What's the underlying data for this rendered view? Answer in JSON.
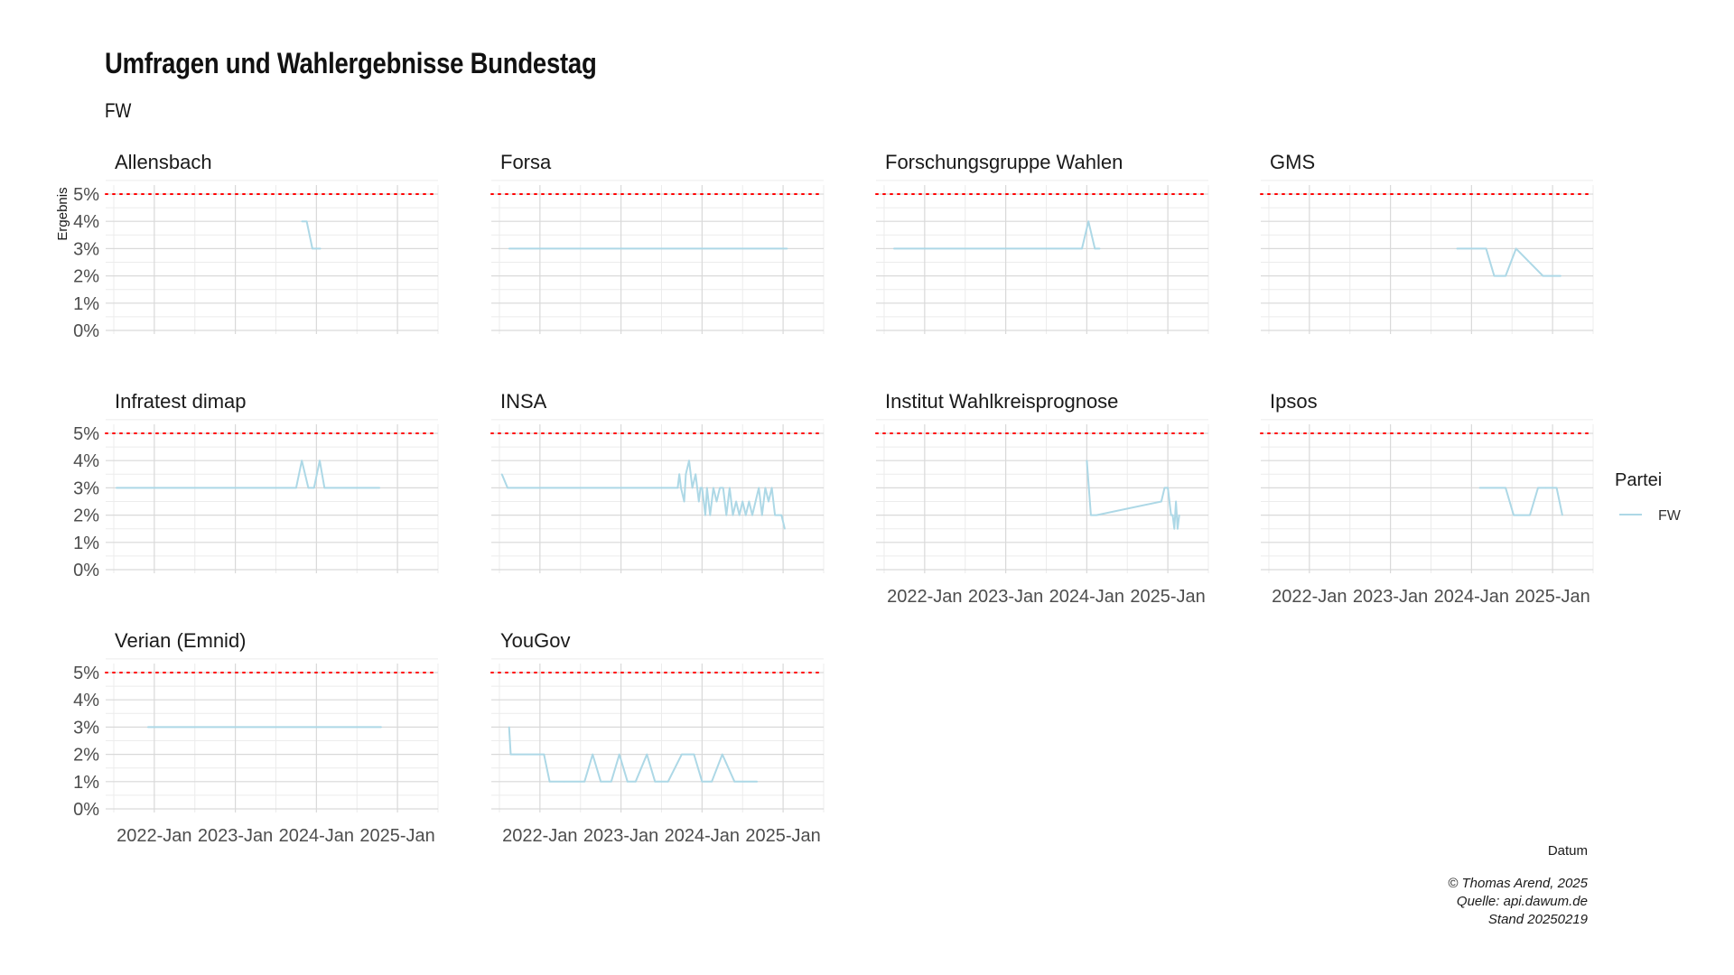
{
  "title": "Umfragen und Wahlergebnisse Bundestag",
  "subtitle": "FW",
  "chart_data": {
    "type": "line",
    "ylabel": "Ergebnis",
    "xlabel": "Datum",
    "ylim": [
      0,
      5
    ],
    "y_ticks": [
      "0%",
      "1%",
      "2%",
      "3%",
      "4%",
      "5%"
    ],
    "x_range": [
      2021.4,
      2025.5
    ],
    "x_ticks": [
      {
        "value": 2022,
        "label": "2022-Jan"
      },
      {
        "value": 2023,
        "label": "2023-Jan"
      },
      {
        "value": 2024,
        "label": "2024-Jan"
      },
      {
        "value": 2025,
        "label": "2025-Jan"
      }
    ],
    "threshold": 5,
    "threshold_color": "#ff0000",
    "line_color": "#add8e6",
    "grid": true,
    "legend_title": "Partei",
    "legend_position": "right",
    "series_name": "FW",
    "panels": [
      {
        "name": "Allensbach",
        "x": [
          2023.82,
          2023.88,
          2023.95,
          2024.05
        ],
        "y": [
          4,
          4,
          3,
          3
        ]
      },
      {
        "name": "Forsa",
        "x": [
          2021.62,
          2025.05
        ],
        "y": [
          3,
          3
        ]
      },
      {
        "name": "Forschungsgruppe Wahlen",
        "x": [
          2021.62,
          2023.94,
          2024.02,
          2024.1,
          2024.16
        ],
        "y": [
          3,
          3,
          4,
          3,
          3
        ]
      },
      {
        "name": "GMS",
        "x": [
          2023.82,
          2024.18,
          2024.28,
          2024.42,
          2024.55,
          2024.88,
          2025.1
        ],
        "y": [
          3,
          3,
          2,
          2,
          3,
          2,
          2
        ]
      },
      {
        "name": "Infratest dimap",
        "x": [
          2021.53,
          2023.75,
          2023.82,
          2023.9,
          2023.97,
          2024.04,
          2024.1,
          2024.5,
          2024.78
        ],
        "y": [
          3,
          3,
          4,
          3,
          3,
          4,
          3,
          3,
          3
        ]
      },
      {
        "name": "INSA",
        "x": [
          2021.53,
          2021.6,
          2023.7,
          2023.72,
          2023.74,
          2023.78,
          2023.8,
          2023.84,
          2023.88,
          2023.92,
          2023.94,
          2023.96,
          2023.98,
          2024.0,
          2024.04,
          2024.06,
          2024.1,
          2024.14,
          2024.18,
          2024.22,
          2024.26,
          2024.3,
          2024.34,
          2024.38,
          2024.42,
          2024.46,
          2024.5,
          2024.54,
          2024.58,
          2024.62,
          2024.66,
          2024.7,
          2024.74,
          2024.78,
          2024.82,
          2024.86,
          2024.9,
          2024.94,
          2024.98,
          2025.02
        ],
        "y": [
          3.5,
          3,
          3,
          3.5,
          3,
          2.5,
          3.5,
          4,
          3,
          3.5,
          3,
          2.5,
          3,
          3,
          2,
          3,
          2,
          3,
          2.5,
          3,
          3,
          2,
          3,
          2,
          2.5,
          2,
          2.5,
          2,
          2.5,
          2,
          2.5,
          3,
          2,
          3,
          2.5,
          3,
          2,
          2,
          2,
          1.5
        ]
      },
      {
        "name": "Institut Wahlkreisprognose",
        "x": [
          2024.0,
          2024.05,
          2024.12,
          2024.92,
          2024.96,
          2025.0,
          2025.04,
          2025.06,
          2025.08,
          2025.1,
          2025.12,
          2025.14
        ],
        "y": [
          4,
          2,
          2,
          2.5,
          3,
          3,
          2,
          2,
          1.5,
          2.5,
          1.5,
          2
        ]
      },
      {
        "name": "Ipsos",
        "x": [
          2024.1,
          2024.42,
          2024.52,
          2024.72,
          2024.82,
          2024.92,
          2025.05,
          2025.12
        ],
        "y": [
          3,
          3,
          2,
          2,
          3,
          3,
          3,
          2
        ]
      },
      {
        "name": "Verian (Emnid)",
        "x": [
          2021.92,
          2024.8
        ],
        "y": [
          3,
          3
        ]
      },
      {
        "name": "YouGov",
        "x": [
          2021.62,
          2021.64,
          2021.68,
          2022.05,
          2022.12,
          2022.3,
          2022.55,
          2022.65,
          2022.75,
          2022.88,
          2022.98,
          2023.08,
          2023.18,
          2023.32,
          2023.42,
          2023.58,
          2023.75,
          2023.9,
          2024.0,
          2024.12,
          2024.25,
          2024.4,
          2024.52,
          2024.68
        ],
        "y": [
          3,
          2,
          2,
          2,
          1,
          1,
          1,
          2,
          1,
          1,
          2,
          1,
          1,
          2,
          1,
          1,
          2,
          2,
          1,
          1,
          2,
          1,
          1,
          1
        ]
      }
    ]
  },
  "caption": {
    "line1": "© Thomas Arend, 2025",
    "line2": "Quelle: api.dawum.de",
    "line3": "Stand 20250219"
  }
}
